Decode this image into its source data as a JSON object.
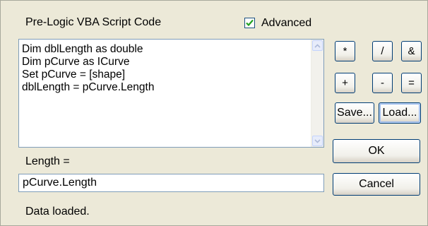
{
  "header": {
    "title": "Pre-Logic VBA Script Code",
    "advanced_label": "Advanced",
    "advanced_checked": true
  },
  "code_lines": [
    "Dim dblLength as double",
    "Dim pCurve as ICurve",
    "Set pCurve = [shape]",
    "dblLength = pCurve.Length"
  ],
  "operators": [
    "*",
    "/",
    "&",
    "+",
    "-",
    "="
  ],
  "buttons": {
    "save": "Save...",
    "load": "Load...",
    "ok": "OK",
    "cancel": "Cancel"
  },
  "expression": {
    "label": "Length =",
    "value": "pCurve.Length"
  },
  "status": "Data loaded."
}
